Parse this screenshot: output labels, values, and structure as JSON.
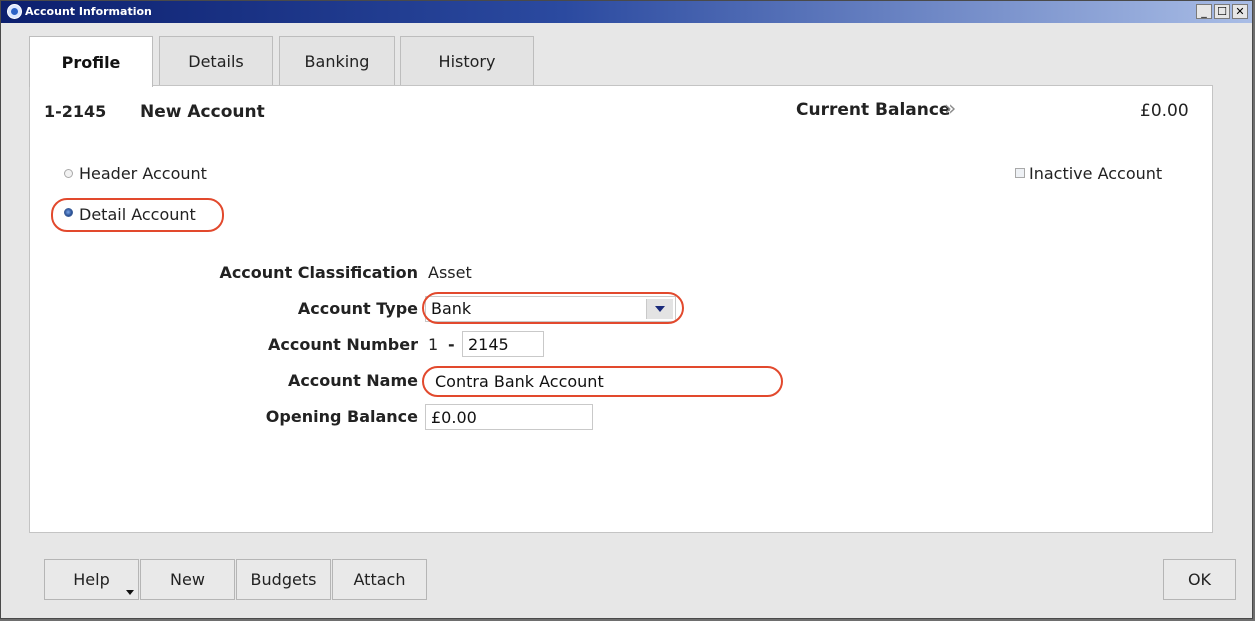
{
  "window": {
    "title": "Account Information",
    "controls": [
      "_",
      "☐",
      "✕"
    ]
  },
  "tabs": [
    {
      "label": "Profile",
      "active": true
    },
    {
      "label": "Details",
      "active": false
    },
    {
      "label": "Banking",
      "active": false
    },
    {
      "label": "History",
      "active": false
    }
  ],
  "header": {
    "account_id": "1-2145",
    "account_title": "New Account",
    "balance_label": "Current Balance",
    "balance_arrow": "»",
    "balance_value": "£0.00"
  },
  "account_kind": {
    "header_label": "Header Account",
    "detail_label": "Detail Account",
    "selected": "detail"
  },
  "inactive": {
    "label": "Inactive Account",
    "checked": false
  },
  "form": {
    "classification_label": "Account Classification",
    "classification_value": "Asset",
    "type_label": "Account Type",
    "type_value": "Bank",
    "number_label": "Account Number",
    "number_prefix": "1",
    "number_sep": "-",
    "number_value": "2145",
    "name_label": "Account Name",
    "name_value": "Contra Bank Account",
    "opening_label": "Opening Balance",
    "opening_value": "£0.00"
  },
  "buttons": {
    "help": "Help",
    "new": "New",
    "budgets": "Budgets",
    "attach": "Attach",
    "ok": "OK"
  },
  "colors": {
    "highlight": "#e2492d",
    "titlebar_start": "#0c1f6e",
    "titlebar_end": "#a9bde6"
  }
}
